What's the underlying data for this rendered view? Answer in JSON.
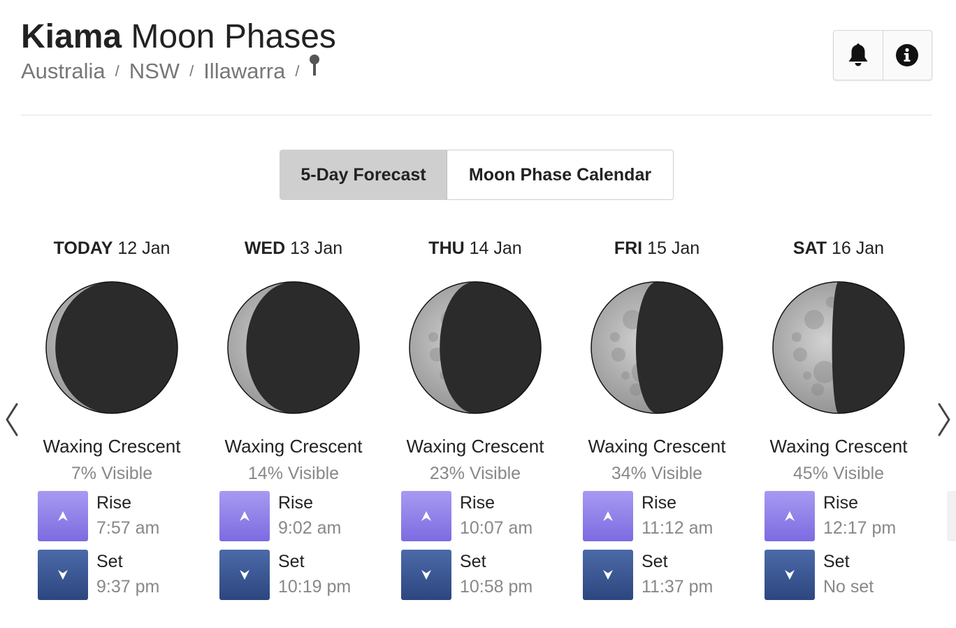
{
  "header": {
    "city": "Kiama",
    "title_rest": "Moon Phases",
    "breadcrumb": [
      "Australia",
      "NSW",
      "Illawarra"
    ],
    "separator": "/"
  },
  "actions": {
    "icons": [
      "bell-icon",
      "info-icon"
    ]
  },
  "tabs": [
    {
      "label": "5-Day Forecast",
      "active": true
    },
    {
      "label": "Moon Phase Calendar",
      "active": false
    }
  ],
  "days": [
    {
      "dow": "TODAY",
      "date": "12 Jan",
      "phase": "Waxing Crescent",
      "visible": "7% Visible",
      "rise_label": "Rise",
      "rise": "7:57 am",
      "set_label": "Set",
      "set": "9:37 pm",
      "illumination": 0.07
    },
    {
      "dow": "WED",
      "date": "13 Jan",
      "phase": "Waxing Crescent",
      "visible": "14% Visible",
      "rise_label": "Rise",
      "rise": "9:02 am",
      "set_label": "Set",
      "set": "10:19 pm",
      "illumination": 0.14
    },
    {
      "dow": "THU",
      "date": "14 Jan",
      "phase": "Waxing Crescent",
      "visible": "23% Visible",
      "rise_label": "Rise",
      "rise": "10:07 am",
      "set_label": "Set",
      "set": "10:58 pm",
      "illumination": 0.23
    },
    {
      "dow": "FRI",
      "date": "15 Jan",
      "phase": "Waxing Crescent",
      "visible": "34% Visible",
      "rise_label": "Rise",
      "rise": "11:12 am",
      "set_label": "Set",
      "set": "11:37 pm",
      "illumination": 0.34
    },
    {
      "dow": "SAT",
      "date": "16 Jan",
      "phase": "Waxing Crescent",
      "visible": "45% Visible",
      "rise_label": "Rise",
      "rise": "12:17 pm",
      "set_label": "Set",
      "set": "No set",
      "illumination": 0.45
    }
  ],
  "colors": {
    "rise": "#7c6be0",
    "set": "#2d467f",
    "moon_dark": "#2b2b2b",
    "moon_lit": "#b9b9b9"
  }
}
